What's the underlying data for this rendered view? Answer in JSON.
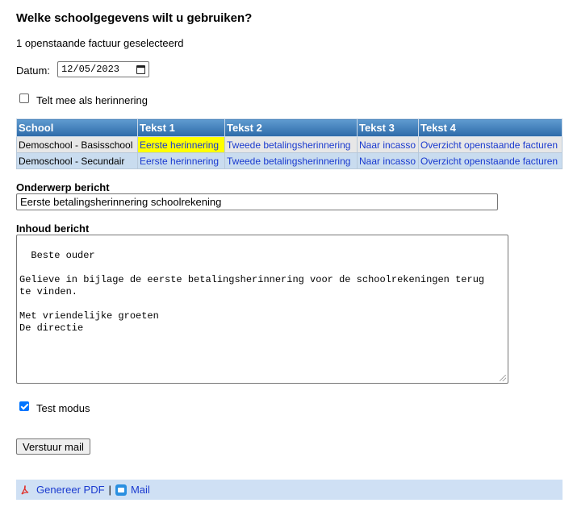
{
  "heading": "Welke schoolgegevens wilt u gebruiken?",
  "subtitle": "1 openstaande factuur geselecteerd",
  "datum": {
    "label": "Datum:",
    "value": "12/05/2023"
  },
  "reminder_checkbox": {
    "label": "Telt mee als herinnering",
    "checked": false
  },
  "table": {
    "headers": [
      "School",
      "Tekst 1",
      "Tekst 2",
      "Tekst 3",
      "Tekst 4"
    ],
    "rows": [
      {
        "school": "Demoschool - Basisschool",
        "tekst1": "Eerste herinnering",
        "tekst2": "Tweede betalingsherinnering",
        "tekst3": "Naar incasso",
        "tekst4": "Overzicht openstaande facturen"
      },
      {
        "school": "Demoschool - Secundair",
        "tekst1": "Eerste herinnering",
        "tekst2": "Tweede betalingsherinnering",
        "tekst3": "Naar incasso",
        "tekst4": "Overzicht openstaande facturen"
      }
    ],
    "highlight_color": "#ffff00"
  },
  "subject": {
    "label": "Onderwerp bericht",
    "value": "Eerste betalingsherinnering schoolrekening"
  },
  "body": {
    "label": "Inhoud bericht",
    "value": "Beste ouder\n\nGelieve in bijlage de eerste betalingsherinnering voor de schoolrekeningen terug\nte vinden.\n\nMet vriendelijke groeten\nDe directie"
  },
  "test_mode": {
    "label": "Test modus",
    "checked": true
  },
  "send_button": "Verstuur mail",
  "footer": {
    "pdf_label": "Genereer PDF",
    "separator": "|",
    "mail_label": "Mail",
    "pdf_icon": "pdf-icon",
    "mail_icon": "mail-icon"
  }
}
